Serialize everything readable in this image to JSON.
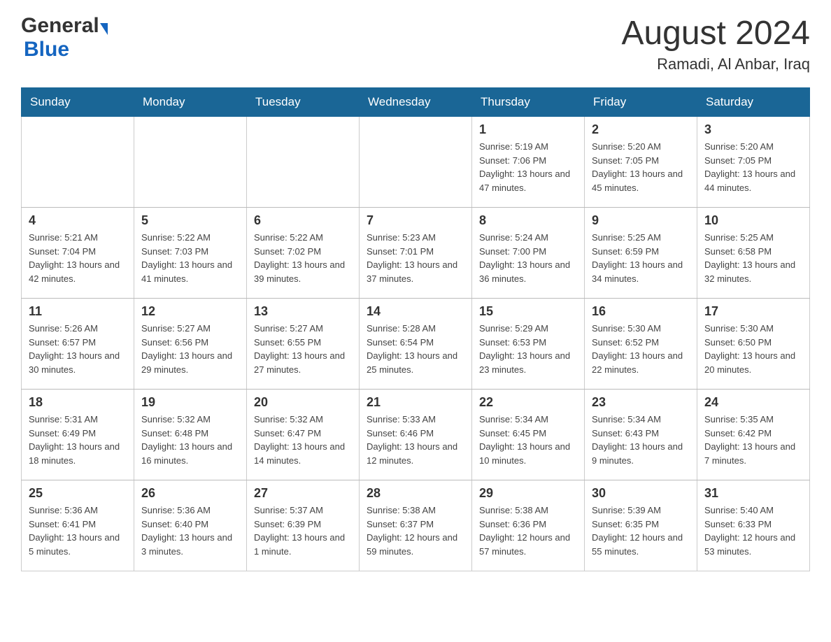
{
  "header": {
    "logo_general": "General",
    "logo_blue": "Blue",
    "month_year": "August 2024",
    "location": "Ramadi, Al Anbar, Iraq"
  },
  "days_of_week": [
    "Sunday",
    "Monday",
    "Tuesday",
    "Wednesday",
    "Thursday",
    "Friday",
    "Saturday"
  ],
  "weeks": [
    {
      "days": [
        {
          "num": "",
          "info": ""
        },
        {
          "num": "",
          "info": ""
        },
        {
          "num": "",
          "info": ""
        },
        {
          "num": "",
          "info": ""
        },
        {
          "num": "1",
          "info": "Sunrise: 5:19 AM\nSunset: 7:06 PM\nDaylight: 13 hours and 47 minutes."
        },
        {
          "num": "2",
          "info": "Sunrise: 5:20 AM\nSunset: 7:05 PM\nDaylight: 13 hours and 45 minutes."
        },
        {
          "num": "3",
          "info": "Sunrise: 5:20 AM\nSunset: 7:05 PM\nDaylight: 13 hours and 44 minutes."
        }
      ]
    },
    {
      "days": [
        {
          "num": "4",
          "info": "Sunrise: 5:21 AM\nSunset: 7:04 PM\nDaylight: 13 hours and 42 minutes."
        },
        {
          "num": "5",
          "info": "Sunrise: 5:22 AM\nSunset: 7:03 PM\nDaylight: 13 hours and 41 minutes."
        },
        {
          "num": "6",
          "info": "Sunrise: 5:22 AM\nSunset: 7:02 PM\nDaylight: 13 hours and 39 minutes."
        },
        {
          "num": "7",
          "info": "Sunrise: 5:23 AM\nSunset: 7:01 PM\nDaylight: 13 hours and 37 minutes."
        },
        {
          "num": "8",
          "info": "Sunrise: 5:24 AM\nSunset: 7:00 PM\nDaylight: 13 hours and 36 minutes."
        },
        {
          "num": "9",
          "info": "Sunrise: 5:25 AM\nSunset: 6:59 PM\nDaylight: 13 hours and 34 minutes."
        },
        {
          "num": "10",
          "info": "Sunrise: 5:25 AM\nSunset: 6:58 PM\nDaylight: 13 hours and 32 minutes."
        }
      ]
    },
    {
      "days": [
        {
          "num": "11",
          "info": "Sunrise: 5:26 AM\nSunset: 6:57 PM\nDaylight: 13 hours and 30 minutes."
        },
        {
          "num": "12",
          "info": "Sunrise: 5:27 AM\nSunset: 6:56 PM\nDaylight: 13 hours and 29 minutes."
        },
        {
          "num": "13",
          "info": "Sunrise: 5:27 AM\nSunset: 6:55 PM\nDaylight: 13 hours and 27 minutes."
        },
        {
          "num": "14",
          "info": "Sunrise: 5:28 AM\nSunset: 6:54 PM\nDaylight: 13 hours and 25 minutes."
        },
        {
          "num": "15",
          "info": "Sunrise: 5:29 AM\nSunset: 6:53 PM\nDaylight: 13 hours and 23 minutes."
        },
        {
          "num": "16",
          "info": "Sunrise: 5:30 AM\nSunset: 6:52 PM\nDaylight: 13 hours and 22 minutes."
        },
        {
          "num": "17",
          "info": "Sunrise: 5:30 AM\nSunset: 6:50 PM\nDaylight: 13 hours and 20 minutes."
        }
      ]
    },
    {
      "days": [
        {
          "num": "18",
          "info": "Sunrise: 5:31 AM\nSunset: 6:49 PM\nDaylight: 13 hours and 18 minutes."
        },
        {
          "num": "19",
          "info": "Sunrise: 5:32 AM\nSunset: 6:48 PM\nDaylight: 13 hours and 16 minutes."
        },
        {
          "num": "20",
          "info": "Sunrise: 5:32 AM\nSunset: 6:47 PM\nDaylight: 13 hours and 14 minutes."
        },
        {
          "num": "21",
          "info": "Sunrise: 5:33 AM\nSunset: 6:46 PM\nDaylight: 13 hours and 12 minutes."
        },
        {
          "num": "22",
          "info": "Sunrise: 5:34 AM\nSunset: 6:45 PM\nDaylight: 13 hours and 10 minutes."
        },
        {
          "num": "23",
          "info": "Sunrise: 5:34 AM\nSunset: 6:43 PM\nDaylight: 13 hours and 9 minutes."
        },
        {
          "num": "24",
          "info": "Sunrise: 5:35 AM\nSunset: 6:42 PM\nDaylight: 13 hours and 7 minutes."
        }
      ]
    },
    {
      "days": [
        {
          "num": "25",
          "info": "Sunrise: 5:36 AM\nSunset: 6:41 PM\nDaylight: 13 hours and 5 minutes."
        },
        {
          "num": "26",
          "info": "Sunrise: 5:36 AM\nSunset: 6:40 PM\nDaylight: 13 hours and 3 minutes."
        },
        {
          "num": "27",
          "info": "Sunrise: 5:37 AM\nSunset: 6:39 PM\nDaylight: 13 hours and 1 minute."
        },
        {
          "num": "28",
          "info": "Sunrise: 5:38 AM\nSunset: 6:37 PM\nDaylight: 12 hours and 59 minutes."
        },
        {
          "num": "29",
          "info": "Sunrise: 5:38 AM\nSunset: 6:36 PM\nDaylight: 12 hours and 57 minutes."
        },
        {
          "num": "30",
          "info": "Sunrise: 5:39 AM\nSunset: 6:35 PM\nDaylight: 12 hours and 55 minutes."
        },
        {
          "num": "31",
          "info": "Sunrise: 5:40 AM\nSunset: 6:33 PM\nDaylight: 12 hours and 53 minutes."
        }
      ]
    }
  ]
}
